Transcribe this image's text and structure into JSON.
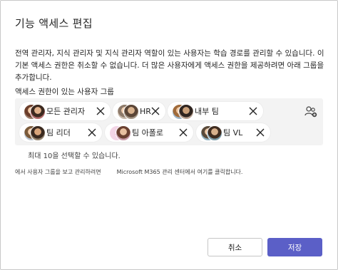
{
  "dialog": {
    "title": "기능 액세스 편집",
    "description": "전역 관리자, 지식 관리자 및 지식 관리자 역할이 있는 사용자는 학습 경로를 관리할 수 있습니다. 이 기본 액세스 권한은 취소할 수 없습니다. 더 많은 사용자에게 액세스 권한을 제공하려면 아래 그룹을 추가합니다.",
    "group_label": "액세스 권한이 있는 사용자 그룹",
    "groups": [
      {
        "label": "모든 관리자",
        "icon": "avatar-pair-icon"
      },
      {
        "label": "HR",
        "icon": "avatar-pair-icon"
      },
      {
        "label": "내부 팀",
        "icon": "avatar-pair-icon"
      },
      {
        "label": "팀 리더",
        "icon": "avatar-pair-icon"
      },
      {
        "label": "팀 아폴로",
        "icon": "avatar-pair-icon"
      },
      {
        "label": "팀 VL",
        "icon": "avatar-pair-icon"
      }
    ],
    "helper_text": "최대 10을 선택할 수 있습니다.",
    "manage_text": "에서 사용자 그룹을 보고 관리하려면",
    "manage_link": "Microsoft M365 관리 센터에서 여기를 클릭합니다.",
    "cancel_label": "취소",
    "save_label": "저장",
    "colors": {
      "primary": "#5b5fc7",
      "group_box": "#f3f3f3",
      "text": "#242424"
    }
  }
}
